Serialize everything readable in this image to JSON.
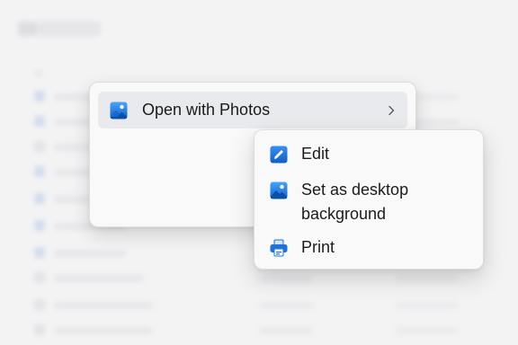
{
  "context_menu": {
    "items": [
      {
        "label": "Open with Photos",
        "icon": "photos-icon",
        "has_submenu": true,
        "highlighted": true
      }
    ]
  },
  "submenu": {
    "items": [
      {
        "label": "Edit",
        "icon": "edit-pen-icon"
      },
      {
        "label": "Set as desktop background",
        "icon": "picture-icon"
      },
      {
        "label": "Print",
        "icon": "printer-icon"
      }
    ]
  },
  "colors": {
    "accent": "#1e73d6",
    "menu_background": "#f9f9f9",
    "highlight": "#e9eaed",
    "text": "#1b1b1b"
  }
}
